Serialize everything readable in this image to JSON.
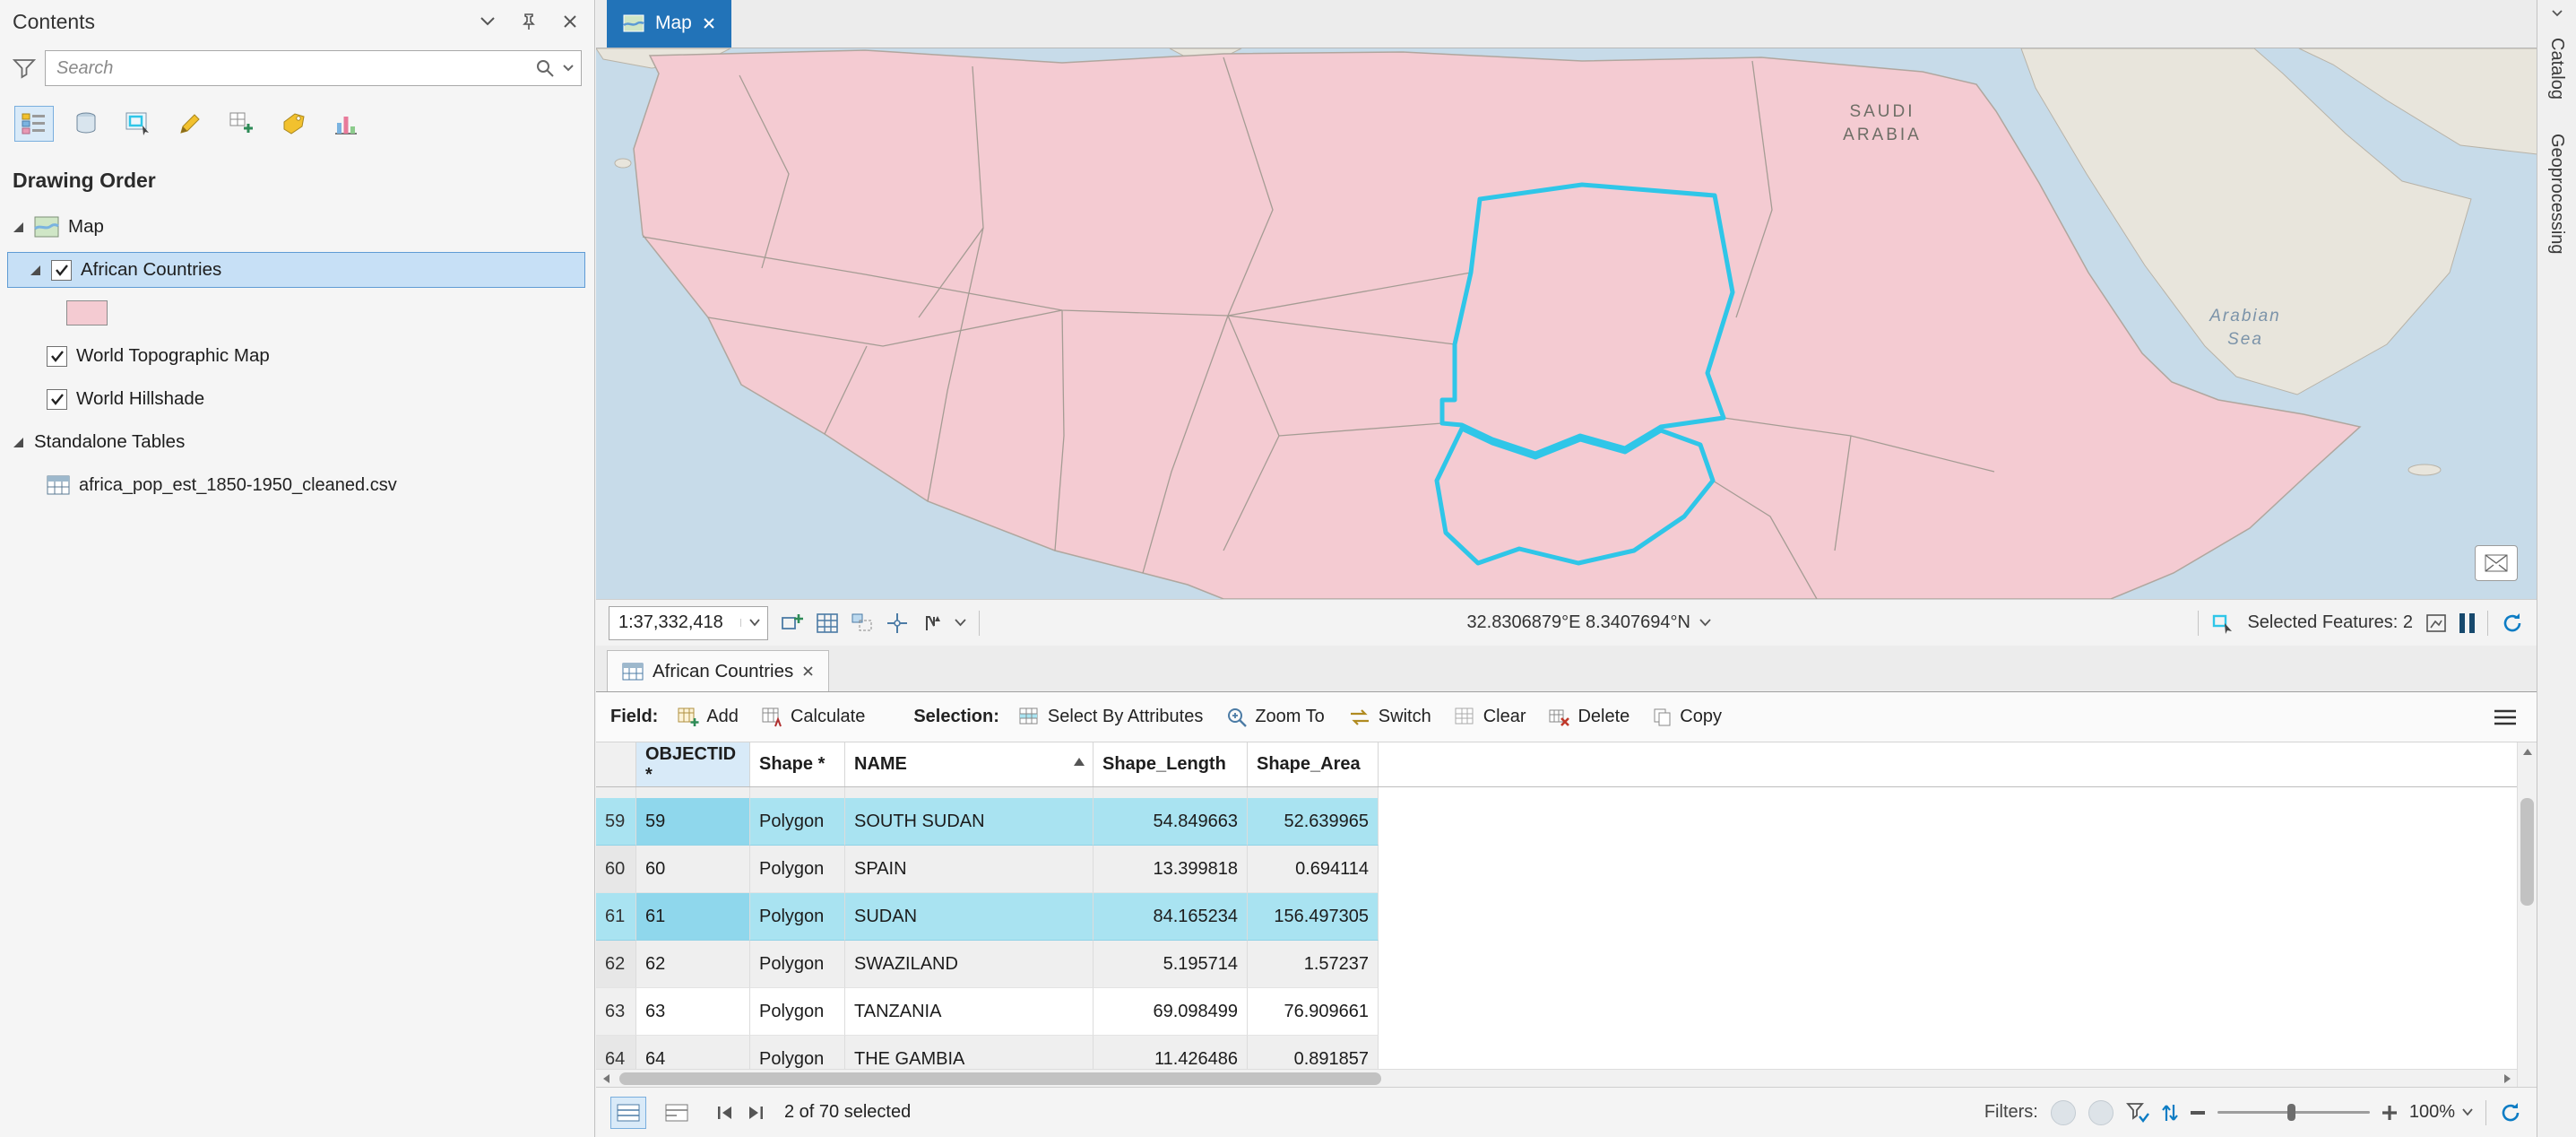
{
  "contents": {
    "title": "Contents",
    "search_placeholder": "Search",
    "drawing_order_heading": "Drawing Order",
    "map_item": "Map",
    "layers": [
      {
        "label": "African Countries",
        "checked": true,
        "selected": true
      },
      {
        "label": "World Topographic Map",
        "checked": true,
        "selected": false
      },
      {
        "label": "World Hillshade",
        "checked": true,
        "selected": false
      }
    ],
    "standalone_tables_label": "Standalone Tables",
    "csv_item": "africa_pop_est_1850-1950_cleaned.csv"
  },
  "map": {
    "tab_label": "Map",
    "labels": {
      "saudi_line1": "SAUDI",
      "saudi_line2": "ARABIA",
      "sea_line1": "Arabian",
      "sea_line2": "Sea"
    },
    "statusbar": {
      "scale": "1:37,332,418",
      "coordinates": "32.8306879°E 8.3407694°N",
      "selected_features": "Selected Features: 2"
    }
  },
  "right_panel_tabs": [
    {
      "label": "Catalog"
    },
    {
      "label": "Geoprocessing"
    }
  ],
  "table": {
    "tab_label": "African Countries",
    "toolbar": {
      "field_label": "Field:",
      "add": "Add",
      "calculate": "Calculate",
      "selection_label": "Selection:",
      "select_by_attributes": "Select By Attributes",
      "zoom_to": "Zoom To",
      "switch": "Switch",
      "clear": "Clear",
      "delete": "Delete",
      "copy": "Copy"
    },
    "columns": {
      "objectid": "OBJECTID *",
      "shape": "Shape *",
      "name": "NAME",
      "shape_length": "Shape_Length",
      "shape_area": "Shape_Area"
    },
    "rows": [
      {
        "num": "59",
        "objectid": "59",
        "shape": "Polygon",
        "name": "SOUTH SUDAN",
        "shape_length": "54.849663",
        "shape_area": "52.639965",
        "selected": true
      },
      {
        "num": "60",
        "objectid": "60",
        "shape": "Polygon",
        "name": "SPAIN",
        "shape_length": "13.399818",
        "shape_area": "0.694114",
        "selected": false
      },
      {
        "num": "61",
        "objectid": "61",
        "shape": "Polygon",
        "name": "SUDAN",
        "shape_length": "84.165234",
        "shape_area": "156.497305",
        "selected": true
      },
      {
        "num": "62",
        "objectid": "62",
        "shape": "Polygon",
        "name": "SWAZILAND",
        "shape_length": "5.195714",
        "shape_area": "1.57237",
        "selected": false
      },
      {
        "num": "63",
        "objectid": "63",
        "shape": "Polygon",
        "name": "TANZANIA",
        "shape_length": "69.098499",
        "shape_area": "76.909661",
        "selected": false
      },
      {
        "num": "64",
        "objectid": "64",
        "shape": "Polygon",
        "name": "THE GAMBIA",
        "shape_length": "11.426486",
        "shape_area": "0.891857",
        "selected": false
      }
    ],
    "statusbar": {
      "selected_text": "2 of 70 selected",
      "filters_label": "Filters:",
      "zoom_value": "100%"
    }
  },
  "colors": {
    "active_tab_blue": "#2273b8",
    "africa_fill_pink": "#f4cbd2",
    "selection_outline_cyan": "#2fc6e8",
    "selected_row_cyan": "#a9e3f1"
  },
  "icons": {
    "search": "magnifier",
    "filter": "funnel",
    "close": "x-cross",
    "pin": "pushpin",
    "pause": "double-bar",
    "refresh": "circular-arrow",
    "sort": "triangle-up"
  }
}
